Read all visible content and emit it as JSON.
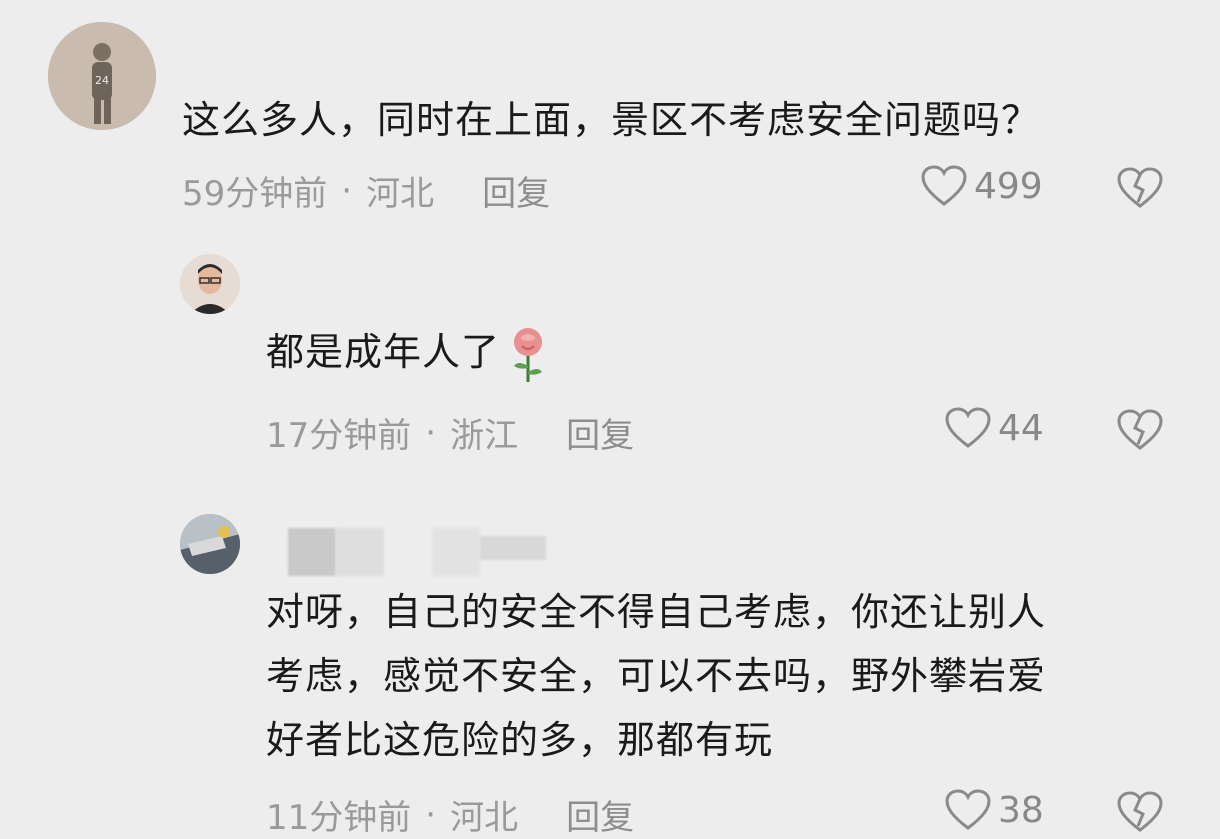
{
  "comments": [
    {
      "text": "这么多人，同时在上面，景区不考虑安全问题吗？",
      "time": "59分钟前",
      "location": "河北",
      "reply": "回复",
      "likes": "499",
      "avatar_text": "24"
    },
    {
      "text": "都是成年人了",
      "time": "17分钟前",
      "location": "浙江",
      "reply": "回复",
      "likes": "44"
    },
    {
      "text_lines": [
        "对呀，自己的安全不得自己考虑，你还让别人",
        "考虑，感觉不安全，可以不去吗，野外攀岩爱",
        "好者比这危险的多，那都有玩"
      ],
      "time": "11分钟前",
      "location": "河北",
      "reply": "回复",
      "likes": "38"
    }
  ],
  "separator": "·",
  "colors": {
    "background": "#ededed",
    "text": "#1a1a1a",
    "meta": "#9a9a9a"
  }
}
